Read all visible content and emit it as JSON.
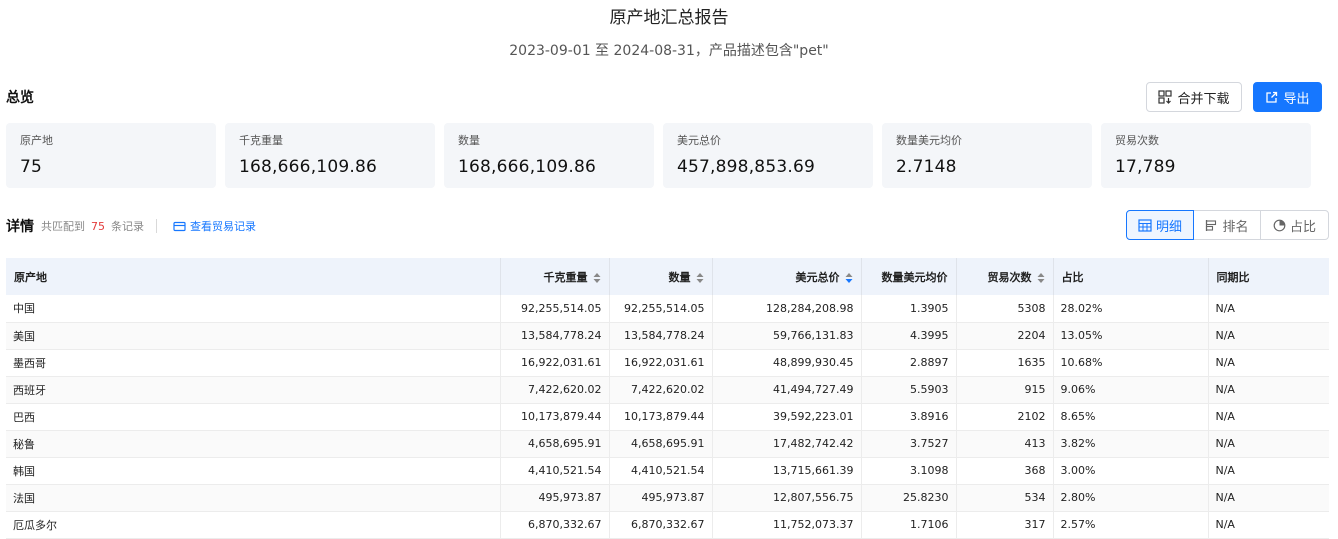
{
  "report": {
    "title": "原产地汇总报告",
    "subtitle": "2023-09-01 至 2024-08-31，产品描述包含\"pet\""
  },
  "overview": {
    "title": "总览",
    "merge_download_label": "合并下载",
    "export_label": "导出",
    "stats": [
      {
        "label": "原产地",
        "value": "75"
      },
      {
        "label": "千克重量",
        "value": "168,666,109.86"
      },
      {
        "label": "数量",
        "value": "168,666,109.86"
      },
      {
        "label": "美元总价",
        "value": "457,898,853.69"
      },
      {
        "label": "数量美元均价",
        "value": "2.7148"
      },
      {
        "label": "贸易次数",
        "value": "17,789"
      }
    ]
  },
  "details": {
    "title": "详情",
    "count_prefix": "共匹配到",
    "count": "75",
    "count_suffix": "条记录",
    "view_records_label": "查看贸易记录",
    "views": [
      "明细",
      "排名",
      "占比"
    ],
    "active_view": "明细"
  },
  "table": {
    "columns": [
      "原产地",
      "千克重量",
      "数量",
      "美元总价",
      "数量美元均价",
      "贸易次数",
      "占比",
      "同期比"
    ],
    "sorted_column": "美元总价",
    "sort_direction": "desc",
    "rows": [
      [
        "中国",
        "92,255,514.05",
        "92,255,514.05",
        "128,284,208.98",
        "1.3905",
        "5308",
        "28.02%",
        "N/A"
      ],
      [
        "美国",
        "13,584,778.24",
        "13,584,778.24",
        "59,766,131.83",
        "4.3995",
        "2204",
        "13.05%",
        "N/A"
      ],
      [
        "墨西哥",
        "16,922,031.61",
        "16,922,031.61",
        "48,899,930.45",
        "2.8897",
        "1635",
        "10.68%",
        "N/A"
      ],
      [
        "西班牙",
        "7,422,620.02",
        "7,422,620.02",
        "41,494,727.49",
        "5.5903",
        "915",
        "9.06%",
        "N/A"
      ],
      [
        "巴西",
        "10,173,879.44",
        "10,173,879.44",
        "39,592,223.01",
        "3.8916",
        "2102",
        "8.65%",
        "N/A"
      ],
      [
        "秘鲁",
        "4,658,695.91",
        "4,658,695.91",
        "17,482,742.42",
        "3.7527",
        "413",
        "3.82%",
        "N/A"
      ],
      [
        "韩国",
        "4,410,521.54",
        "4,410,521.54",
        "13,715,661.39",
        "3.1098",
        "368",
        "3.00%",
        "N/A"
      ],
      [
        "法国",
        "495,973.87",
        "495,973.87",
        "12,807,556.75",
        "25.8230",
        "534",
        "2.80%",
        "N/A"
      ],
      [
        "厄瓜多尔",
        "6,870,332.67",
        "6,870,332.67",
        "11,752,073.37",
        "1.7106",
        "317",
        "2.57%",
        "N/A"
      ]
    ]
  },
  "colors": {
    "accent": "#1677ff",
    "count_highlight": "#e33c3c",
    "header_bg": "#eef3fb",
    "card_bg": "#f4f6f9"
  },
  "icons": {
    "merge_download": "grid-download-icon",
    "export": "external-link-icon",
    "view_records": "card-icon",
    "views": [
      "table-icon",
      "ranking-icon",
      "pie-icon"
    ]
  }
}
